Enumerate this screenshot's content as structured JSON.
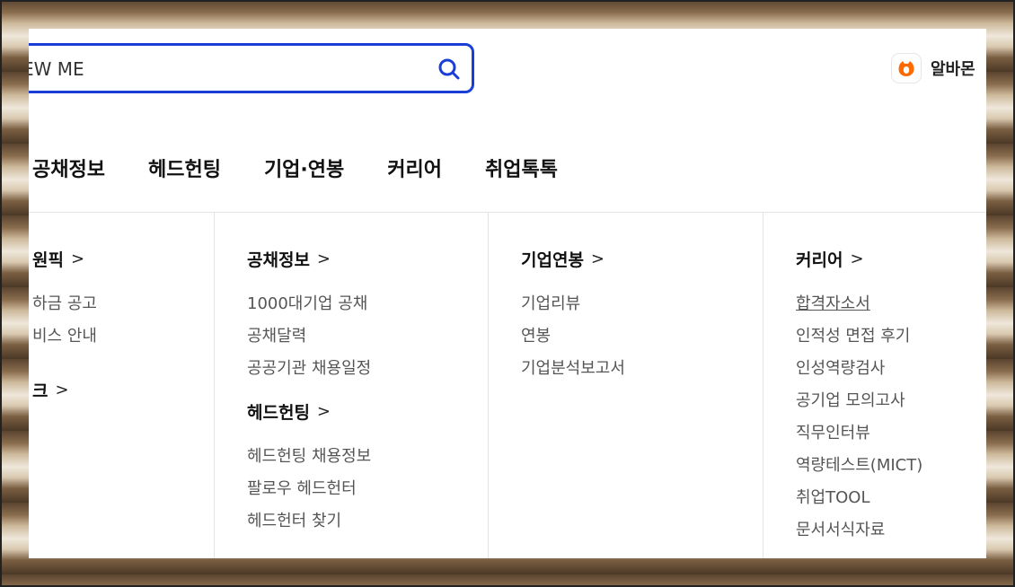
{
  "search": {
    "value": "EW ME",
    "icon": "search-icon"
  },
  "brand": {
    "label": "알바몬",
    "logo_color": "#ff6a00"
  },
  "top_nav": [
    "공채정보",
    "헤드헌팅",
    "기업·연봉",
    "커리어",
    "취업톡톡"
  ],
  "columns": [
    {
      "sections": [
        {
          "title": "원픽",
          "links": [
            "하금 공고",
            "비스 안내"
          ]
        },
        {
          "title": "크",
          "links": []
        }
      ]
    },
    {
      "sections": [
        {
          "title": "공채정보",
          "links": [
            "1000대기업 공채",
            "공채달력",
            "공공기관 채용일정"
          ]
        },
        {
          "title": "헤드헌팅",
          "links": [
            "헤드헌팅 채용정보",
            "팔로우 헤드헌터",
            "헤드헌터 찾기"
          ]
        }
      ]
    },
    {
      "sections": [
        {
          "title": "기업연봉",
          "links": [
            "기업리뷰",
            "연봉",
            "기업분석보고서"
          ]
        }
      ]
    },
    {
      "sections": [
        {
          "title": "커리어",
          "links": [
            "합격자소서",
            "인적성 면접 후기",
            "인성역량검사",
            "공기업 모의고사",
            "직무인터뷰",
            "역량테스트(MICT)",
            "취업TOOL",
            "문서서식자료"
          ]
        }
      ]
    }
  ],
  "colors": {
    "accent": "#1a3ed6",
    "text": "#111111",
    "link": "#555555"
  }
}
